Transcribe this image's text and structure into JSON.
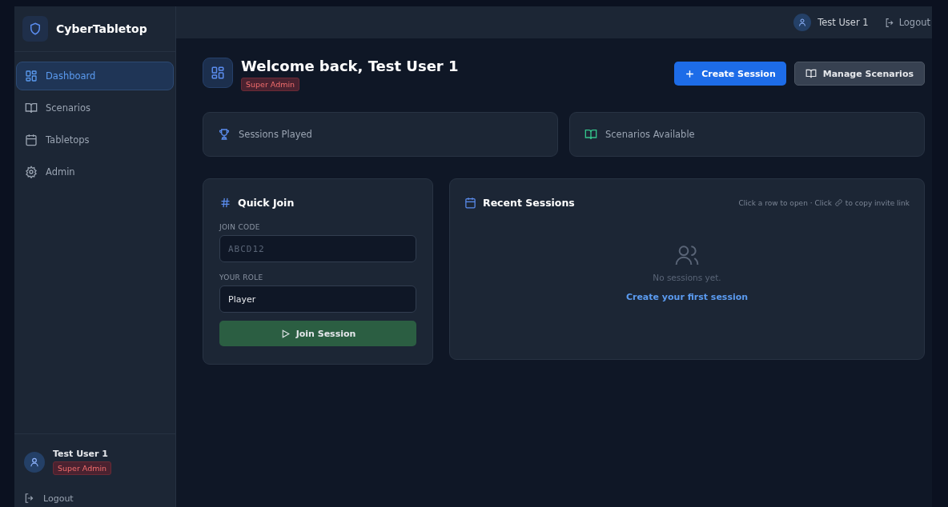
{
  "sidebar": {
    "brand": "CyberTabletop",
    "items": [
      {
        "label": "Dashboard",
        "kind": "grid",
        "selected": true
      },
      {
        "label": "Scenarios",
        "kind": "book",
        "selected": false
      },
      {
        "label": "Tabletops",
        "kind": "calendar",
        "selected": false
      },
      {
        "label": "Admin",
        "kind": "gear",
        "selected": false
      }
    ],
    "user": {
      "name": "Test User 1",
      "role": "Super Admin"
    },
    "logout": "Logout"
  },
  "topbar": {
    "user": "Test User 1",
    "logout": "Logout"
  },
  "header": {
    "title": "Welcome back, Test User 1",
    "role": "Super Admin",
    "buttons": [
      {
        "label": "Create Session",
        "kind": "primary"
      },
      {
        "label": "Manage Scenarios",
        "kind": "secondary"
      }
    ]
  },
  "stats": [
    {
      "label": "Sessions Played",
      "kind": "trophy"
    },
    {
      "label": "Scenarios Available",
      "kind": "book"
    }
  ],
  "quick_join": {
    "title": "Quick Join",
    "code_label": "JOIN CODE",
    "code_placeholder": "ABCD12",
    "role_label": "YOUR ROLE",
    "role_value": "Player",
    "button": "Join Session"
  },
  "recent_sessions": {
    "title": "Recent Sessions",
    "hint_before": "Click a row to open · Click",
    "hint_after": "to copy invite link",
    "empty": "No sessions yet.",
    "link": "Create your first session"
  }
}
